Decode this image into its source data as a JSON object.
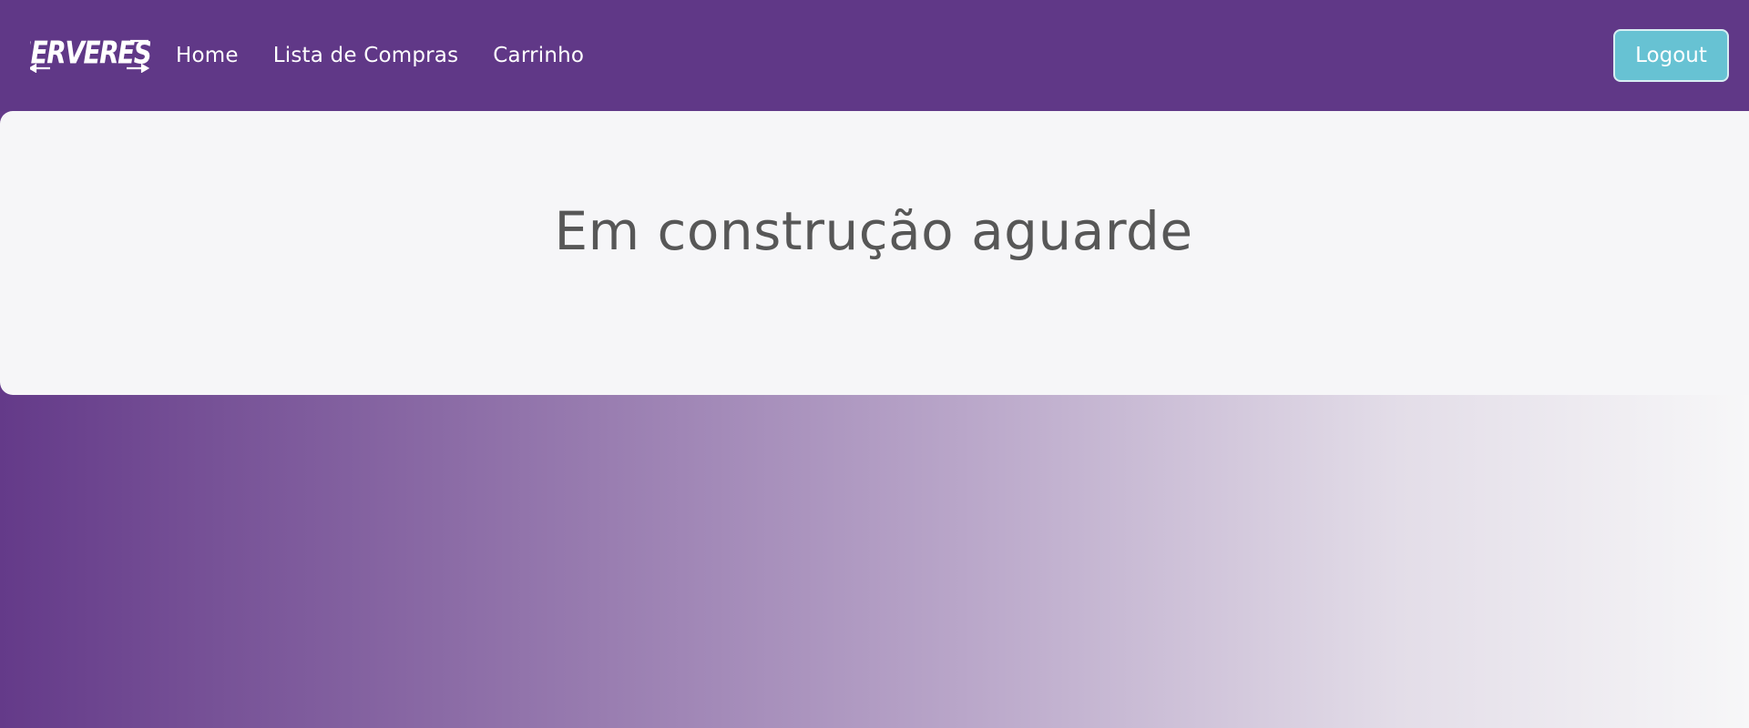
{
  "brand": {
    "logo_text": "SERVEREST",
    "icon": "serverest-logo"
  },
  "nav": {
    "items": [
      {
        "label": "Home"
      },
      {
        "label": "Lista de Compras"
      },
      {
        "label": "Carrinho"
      }
    ],
    "logout_label": "Logout"
  },
  "main": {
    "heading": "Em construção aguarde"
  },
  "colors": {
    "navbar": "#603887",
    "logout_button": "#67c2d3",
    "jumbotron": "#f6f6f8",
    "heading_text": "#575757"
  }
}
